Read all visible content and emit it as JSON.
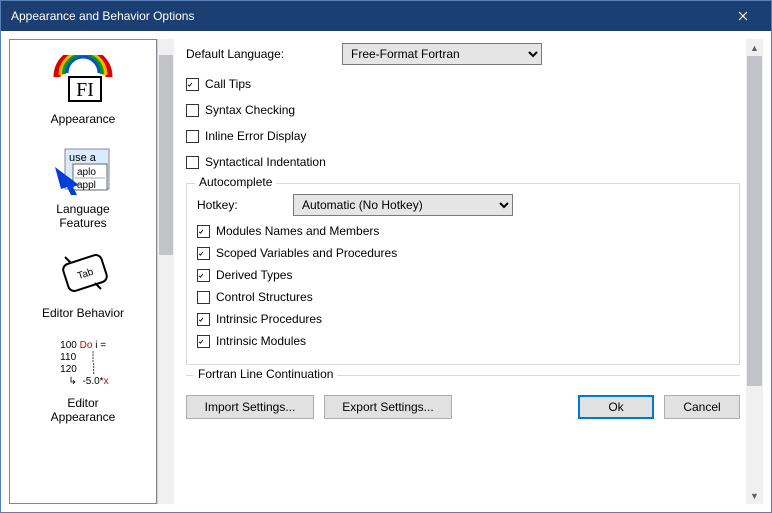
{
  "window": {
    "title": "Appearance and Behavior Options"
  },
  "sidebar": {
    "items": [
      {
        "label": "Appearance"
      },
      {
        "label": "Language\nFeatures"
      },
      {
        "label": "Editor Behavior"
      },
      {
        "label": "Editor\nAppearance"
      }
    ]
  },
  "main": {
    "default_language_label": "Default Language:",
    "default_language_value": "Free-Format Fortran",
    "call_tips": {
      "label": "Call Tips",
      "checked": true
    },
    "syntax_checking": {
      "label": "Syntax Checking",
      "checked": false
    },
    "inline_error": {
      "label": "Inline Error Display",
      "checked": false
    },
    "syntactical_indent": {
      "label": "Syntactical Indentation",
      "checked": false
    },
    "autocomplete": {
      "legend": "Autocomplete",
      "hotkey_label": "Hotkey:",
      "hotkey_value": "Automatic (No Hotkey)",
      "modules": {
        "label": "Modules Names and Members",
        "checked": true
      },
      "scoped": {
        "label": "Scoped Variables and Procedures",
        "checked": true
      },
      "dtypes": {
        "label": "Derived Types",
        "checked": true
      },
      "ctrl": {
        "label": "Control Structures",
        "checked": false
      },
      "iproc": {
        "label": "Intrinsic Procedures",
        "checked": true
      },
      "imod": {
        "label": "Intrinsic Modules",
        "checked": true
      }
    },
    "fortran_line_cont": "Fortran Line Continuation"
  },
  "buttons": {
    "import": "Import Settings...",
    "export": "Export Settings...",
    "ok": "Ok",
    "cancel": "Cancel"
  }
}
